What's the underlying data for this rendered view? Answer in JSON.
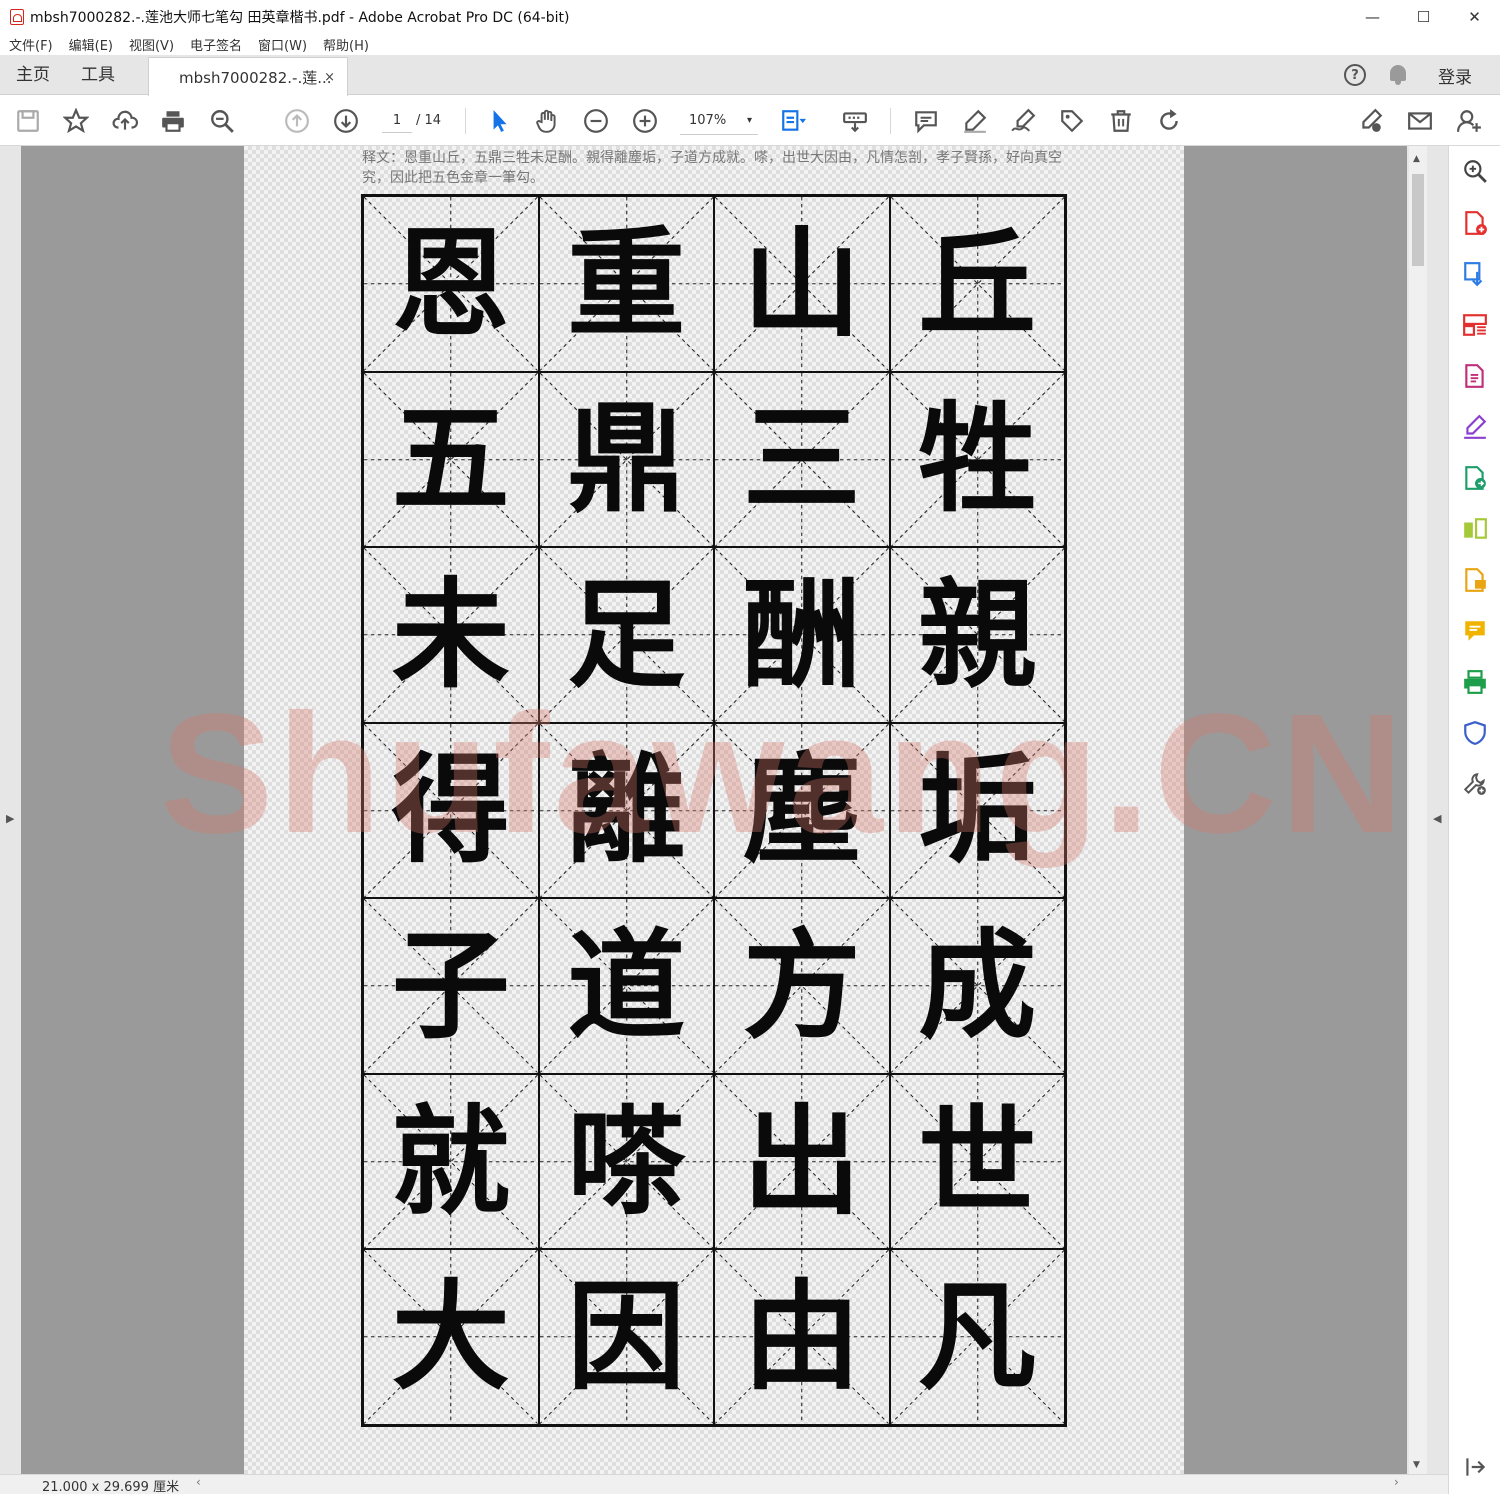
{
  "window": {
    "title": "mbsh7000282.-.莲池大师七笔勾 田英章楷书.pdf - Adobe Acrobat Pro DC (64-bit)",
    "minimize": "—",
    "maximize": "☐",
    "close": "✕"
  },
  "menu": [
    "文件(F)",
    "编辑(E)",
    "视图(V)",
    "电子签名",
    "窗口(W)",
    "帮助(H)"
  ],
  "tabs": {
    "home": "主页",
    "tools": "工具",
    "document": "mbsh7000282.-.莲...",
    "close": "×",
    "help": "?",
    "login": "登录"
  },
  "toolbar": {
    "page_current": "1",
    "page_total": "/ 14",
    "zoom": "107%",
    "zoom_caret": "▾"
  },
  "document": {
    "caption": "释文：恩重山丘，五鼎三牲未足酬。親得離塵垢，子道方成就。嗏，出世大因由，凡情怎剖，孝子賢孫，好向真空究，因此把五色金章一筆勾。",
    "characters": [
      [
        "恩",
        "重",
        "山",
        "丘"
      ],
      [
        "五",
        "鼎",
        "三",
        "牲"
      ],
      [
        "未",
        "足",
        "酬",
        "親"
      ],
      [
        "得",
        "離",
        "塵",
        "垢"
      ],
      [
        "子",
        "道",
        "方",
        "成"
      ],
      [
        "就",
        "嗏",
        "出",
        "世"
      ],
      [
        "大",
        "因",
        "由",
        "凡"
      ]
    ],
    "watermark": "Shufawang.CN"
  },
  "status": {
    "dimensions": "21.000 x 29.699 厘米"
  },
  "colors": {
    "accent": "#1473e6",
    "pdf_red": "#d4261b"
  },
  "right_panel_icons": [
    "search-zoom-icon",
    "create-pdf-icon",
    "export-pdf-icon",
    "organize-pages-icon",
    "edit-pdf-icon",
    "fill-sign-icon",
    "send-for-signature-icon",
    "compare-icon",
    "export-file-icon",
    "comment-icon",
    "print-production-icon",
    "protect-icon",
    "more-tools-icon"
  ]
}
